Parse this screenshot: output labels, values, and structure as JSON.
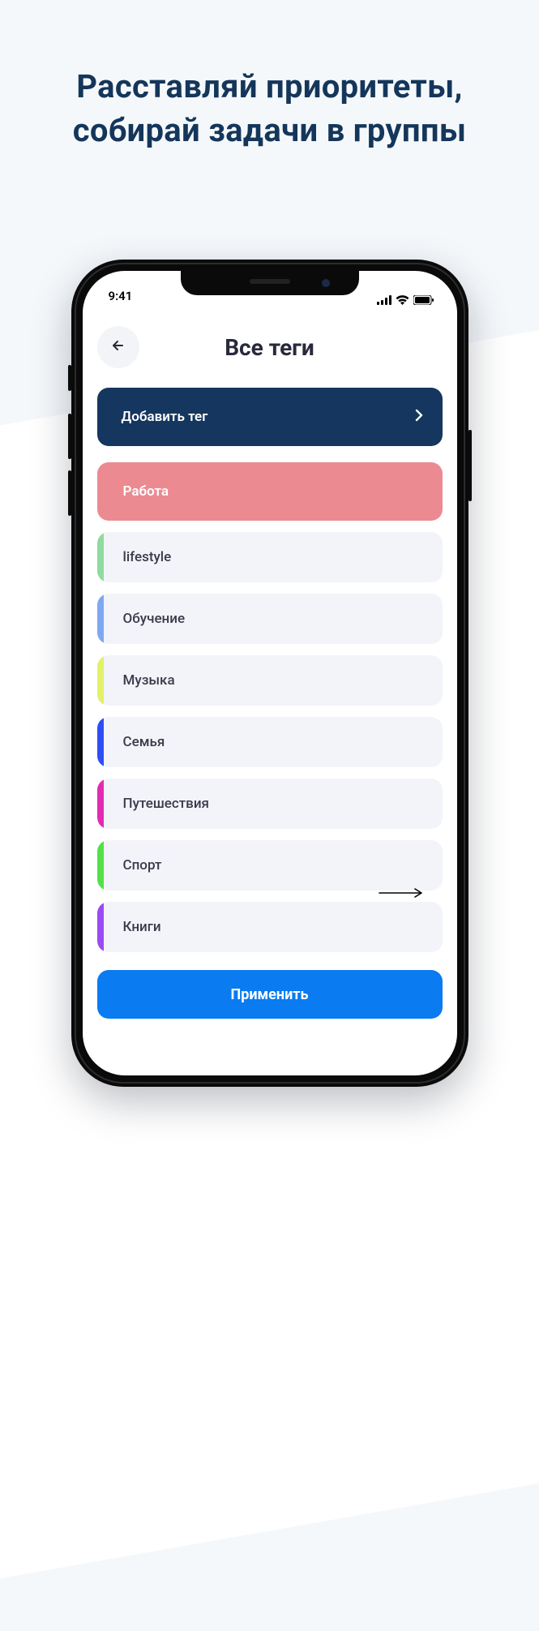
{
  "promo_heading": "Расставляй приоритеты, собирай  задачи в группы",
  "status": {
    "time": "9:41"
  },
  "header": {
    "title": "Все теги"
  },
  "add_tag": {
    "label": "Добавить тег"
  },
  "tags": [
    {
      "label": "Работа",
      "color": "#eb8b91",
      "selected": true
    },
    {
      "label": "lifestyle",
      "color": "#8edc9e",
      "selected": false
    },
    {
      "label": "Обучение",
      "color": "#7ea9f2",
      "selected": false
    },
    {
      "label": "Музыка",
      "color": "#e3f06a",
      "selected": false
    },
    {
      "label": "Семья",
      "color": "#2f4df5",
      "selected": false
    },
    {
      "label": "Путешествия",
      "color": "#e22bb2",
      "selected": false
    },
    {
      "label": "Спорт",
      "color": "#53e049",
      "selected": false
    },
    {
      "label": "Книги",
      "color": "#9a4bf2",
      "selected": false
    }
  ],
  "apply": {
    "label": "Применить"
  }
}
